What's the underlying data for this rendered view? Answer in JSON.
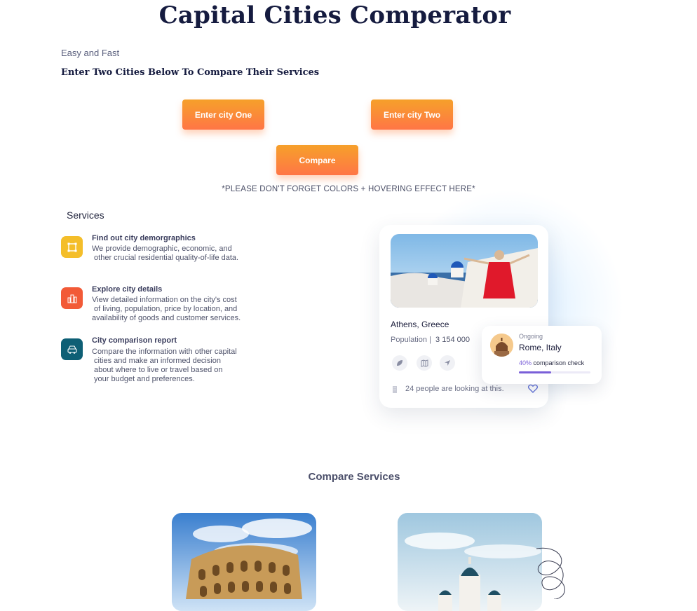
{
  "header": {
    "title": "Capital Cities Comperator",
    "tagline": "Easy and Fast",
    "instruction": "Enter Two Cities Below To Compare Their Services"
  },
  "buttons": {
    "city_one": "Enter city One",
    "city_two": "Enter city  Two",
    "compare": "Compare"
  },
  "note": "*PLEASE DON'T FORGET  COLORS + HOVERING EFFECT HERE*",
  "services": {
    "heading": "Services",
    "items": [
      {
        "title": "Find out city demorgraphics",
        "description": "We provide demographic, economic, and\n other crucial residential quality-of-life data.",
        "icon": "frame-icon",
        "color": "#f4be2a"
      },
      {
        "title": "Explore city details",
        "description": "View detailed information on the city's cost\n of living, population, price by location, and\navailability of goods and customer services.",
        "icon": "city-icon",
        "color": "#f25a37"
      },
      {
        "title": "City comparison report",
        "description": "Compare the information with other capital\n cities and make an informed decision\n about where to live or travel based on\n your budget and preferences.",
        "icon": "car-icon",
        "color": "#0e5f75"
      }
    ]
  },
  "featured_card": {
    "city": "Athens, Greece",
    "population_label": "Population |",
    "population_value": "3 154 000",
    "viewers_text": "24 people are looking at this.",
    "actions": [
      "leaf-icon",
      "map-icon",
      "navigation-icon"
    ]
  },
  "comparison_card": {
    "status": "Ongoing",
    "city": "Rome, Italy",
    "progress_percent": "40%",
    "progress_label": "comparison check",
    "progress_fraction": 0.45
  },
  "compare_services": {
    "heading": "Compare Services"
  },
  "colors": {
    "accent_orange": "#ff8a3a",
    "title_navy": "#151b3f",
    "progress_purple": "#7a5fd8"
  }
}
